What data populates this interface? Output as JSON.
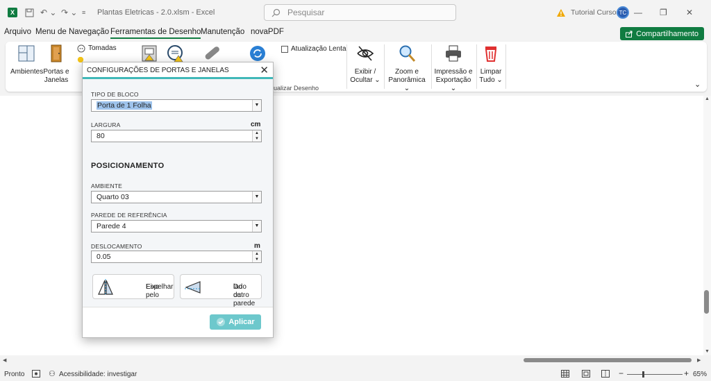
{
  "window": {
    "title": "Plantas Eletricas - 2.0.xlsm - Excel",
    "search_placeholder": "Pesquisar",
    "user_name": "Tutorial Cursos"
  },
  "menu": {
    "items": [
      "Arquivo",
      "Menu de Navegação",
      "Ferramentas de Desenho",
      "Manutenção",
      "novaPDF"
    ],
    "active": "Ferramentas de Desenho",
    "share_label": "Compartilhamento"
  },
  "ribbon": {
    "ambientes": "Ambientes",
    "portas_line1": "Portas e",
    "portas_line2": "Janelas",
    "tomadas": "Tomadas",
    "iluminacao": "Iluminação",
    "atualizacao_lenta": "Atualização Lenta",
    "atualizar_desenho": "ualizar Desenho",
    "exibir_line1": "Exibir /",
    "exibir_line2": "Ocultar",
    "zoom_line1": "Zoom e",
    "zoom_line2": "Panorâmica",
    "impressao_line1": "Impressão e",
    "impressao_line2": "Exportação",
    "limpar_line1": "Limpar",
    "limpar_line2": "Tudo"
  },
  "dialog": {
    "title": "CONFIGURAÇÕES DE PORTAS E JANELAS",
    "tipo_bloco_label": "TIPO DE BLOCO",
    "tipo_bloco_value": "Porta de 1 Folha",
    "largura_label": "LARGURA",
    "largura_unit": "cm",
    "largura_value": "80",
    "posicionamento_title": "POSICIONAMENTO",
    "ambiente_label": "AMBIENTE",
    "ambiente_value": "Quarto 03",
    "parede_label": "PAREDE DE REFERÊNCIA",
    "parede_value": "Parede 4",
    "deslocamento_label": "DESLOCAMENTO",
    "deslocamento_unit": "m",
    "deslocamento_value": "0.05",
    "espelhar_line1": "Espelhar pelo",
    "espelhar_line2": "Eixo",
    "outro_line1": "Do outro",
    "outro_line2": "lado da parede",
    "apply_label": "Aplicar"
  },
  "status": {
    "ready": "Pronto",
    "accessibility": "Acessibilidade: investigar",
    "zoom": "65%"
  },
  "colors": {
    "excel_green": "#107c41",
    "dialog_accent": "#40b8b8",
    "apply_button": "#6dc8cc"
  }
}
